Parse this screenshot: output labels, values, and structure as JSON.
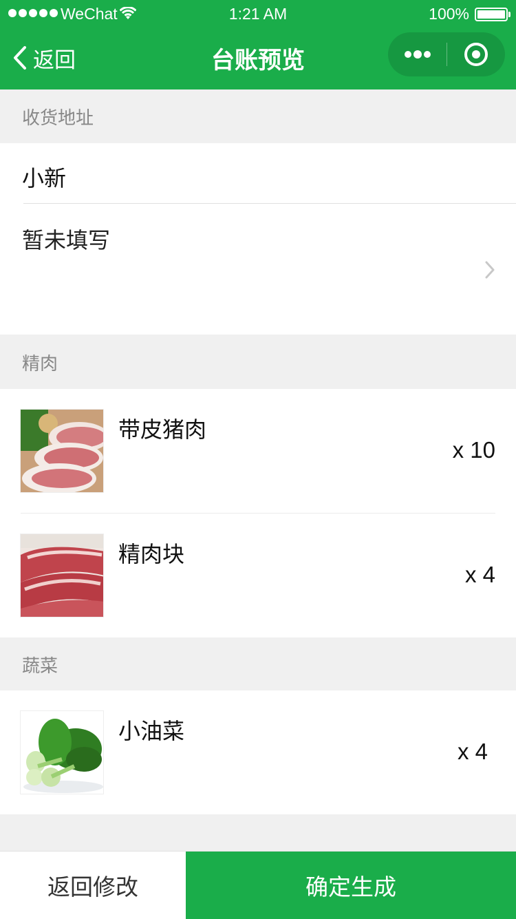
{
  "status_bar": {
    "carrier": "WeChat",
    "time": "1:21 AM",
    "battery": "100%"
  },
  "nav": {
    "back_label": "返回",
    "title": "台账预览",
    "more_icon": "more-dots-icon",
    "close_icon": "record-circle-icon"
  },
  "address": {
    "section_title": "收货地址",
    "name": "小新",
    "detail": "暂未填写"
  },
  "groups": [
    {
      "title": "精肉",
      "items": [
        {
          "name": "带皮猪肉",
          "qty": "x 10",
          "image": "pork-with-skin-image"
        },
        {
          "name": "精肉块",
          "qty": "x 4",
          "image": "lean-pork-chunks-image"
        }
      ]
    },
    {
      "title": "蔬菜",
      "items": [
        {
          "name": "小油菜",
          "qty": "x 4",
          "image": "bok-choy-image"
        }
      ]
    }
  ],
  "footer": {
    "back_edit_label": "返回修改",
    "confirm_label": "确定生成"
  },
  "colors": {
    "brand_green": "#1aad4a",
    "background": "#f0f0f0"
  }
}
